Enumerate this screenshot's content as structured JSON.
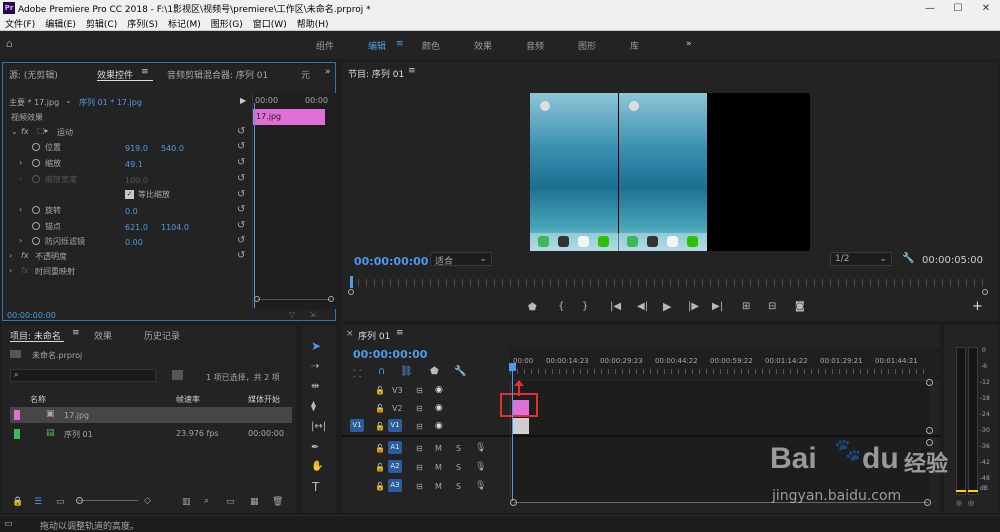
{
  "app": {
    "title": "Adobe Premiere Pro CC 2018 - F:\\1影视区\\视频号\\premiere\\工作区\\未命名.prproj *",
    "logo": "Pr"
  },
  "menu": [
    "文件(F)",
    "编辑(E)",
    "剪辑(C)",
    "序列(S)",
    "标记(M)",
    "图形(G)",
    "窗口(W)",
    "帮助(H)"
  ],
  "workspaces": [
    "组件",
    "编辑",
    "颜色",
    "效果",
    "音频",
    "图形",
    "库"
  ],
  "workspace_more": "»",
  "source_panel": {
    "tabs": [
      "源: (无剪辑)",
      "效果控件",
      "音频剪辑混合器: 序列 01",
      "元"
    ],
    "more": "»",
    "master_label": "主要 * 17.jpg",
    "seq_label": "序列 01 * 17.jpg",
    "ruler_start": "00:00",
    "ruler_end": "00:00",
    "clip_label": "17.jpg",
    "video_effects": "视频效果",
    "motion": "运动",
    "position_label": "位置",
    "position_x": "919.0",
    "position_y": "540.0",
    "scale_label": "缩放",
    "scale_value": "49.1",
    "scale_width_label": "缩放宽度",
    "scale_width_value": "100.0",
    "uniform_scale_label": "等比缩放",
    "rotation_label": "旋转",
    "rotation_value": "0.0",
    "anchor_label": "锚点",
    "anchor_x": "621.0",
    "anchor_y": "1104.0",
    "antiflicker_label": "防闪烁滤镜",
    "antiflicker_value": "0.00",
    "opacity_label": "不透明度",
    "timeremap_label": "时间重映射",
    "timecode": "00:00:00:00",
    "fx_label": "fx"
  },
  "program_panel": {
    "title": "节目: 序列 01",
    "timecode": "00:00:00:00",
    "fit": "适合",
    "resolution": "1/2",
    "duration": "00:00:05:00"
  },
  "project_panel": {
    "tabs": [
      "项目: 未命名",
      "效果",
      "历史记录"
    ],
    "file": "未命名.prproj",
    "selection": "1 项已选择，共 2 项",
    "columns": [
      "名称",
      "帧速率",
      "媒体开始"
    ],
    "items": [
      {
        "name": "17.jpg",
        "rate": "",
        "start": "",
        "color": "#e070d8"
      },
      {
        "name": "序列 01",
        "rate": "23.976 fps",
        "start": "00:00:00",
        "color": "#3cb85a"
      }
    ]
  },
  "timeline": {
    "title": "序列 01",
    "timecode": "00:00:00:00",
    "ruler": [
      "00:00",
      "00:00:14:23",
      "00:00:29:23",
      "00:00:44:22",
      "00:00:59:22",
      "00:01:14:22",
      "00:01:29:21",
      "00:01:44:21"
    ],
    "video_tracks": [
      "V3",
      "V2",
      "V1"
    ],
    "audio_tracks": [
      "A1",
      "A2",
      "A3"
    ],
    "source_patch": "V1",
    "m_label": "M",
    "s_label": "S"
  },
  "meters": [
    "0",
    "-6",
    "-12",
    "-18",
    "-24",
    "-30",
    "-36",
    "-42",
    "-48",
    "dB"
  ],
  "statusbar": "拖动以调整轨道的高度。",
  "watermark": {
    "brand": "Bai",
    "brand2": "du",
    "cn": "经验",
    "url": "jingyan.baidu.com"
  },
  "colors": {
    "accent": "#4e9ae8",
    "clip_pink": "#e070d8",
    "highlight_red": "#e03030",
    "panel": "#232323"
  }
}
